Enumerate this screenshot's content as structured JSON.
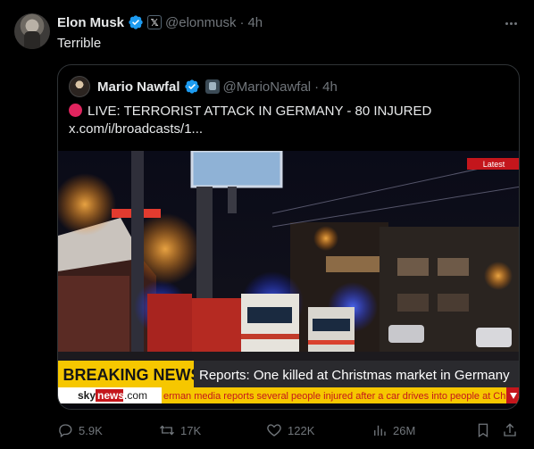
{
  "author": {
    "name": "Elon Musk",
    "handle": "@elonmusk",
    "time": "4h"
  },
  "separator": "·",
  "tweet_text": "Terrible",
  "quoted": {
    "name": "Mario Nawfal",
    "handle": "@MarioNawfal",
    "time": "4h",
    "headline": "LIVE: TERRORIST ATTACK IN GERMANY - 80 INJURED",
    "link": "x.com/i/broadcasts/1..."
  },
  "media": {
    "latest_tag": "Latest",
    "breaking_label": "BREAKING NEWS",
    "headline": "Reports: One killed at Christmas market in Germany",
    "brand_sky": "sky",
    "brand_news": "news",
    "brand_com": ".com",
    "ticker": "erman media reports several people injured after a car drives into people at Christmas ma"
  },
  "stats": {
    "replies": "5.9K",
    "reposts": "17K",
    "likes": "122K",
    "views": "26M"
  },
  "colors": {
    "verified": "#1d9bf0",
    "breaking_red": "#c4161c",
    "ticker_yellow": "#f6c700",
    "accent_gray": "#71767b"
  },
  "icons": [
    "verified-icon",
    "x-logo-icon",
    "more-icon",
    "reply-icon",
    "repost-icon",
    "like-icon",
    "views-icon",
    "bookmark-icon",
    "share-icon"
  ]
}
